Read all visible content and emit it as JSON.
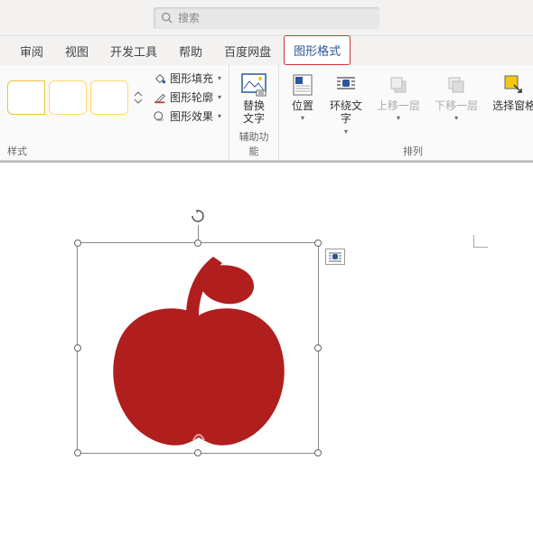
{
  "search": {
    "placeholder": "搜索"
  },
  "tabs": {
    "items": [
      {
        "label": "审阅"
      },
      {
        "label": "视图"
      },
      {
        "label": "开发工具"
      },
      {
        "label": "帮助"
      },
      {
        "label": "百度网盘"
      },
      {
        "label": "图形格式"
      }
    ],
    "active_index": 5
  },
  "ribbon": {
    "styles": {
      "group_label": "样式",
      "fill": "图形填充",
      "outline": "图形轮廓",
      "effects": "图形效果"
    },
    "accessibility": {
      "group_label": "辅助功能",
      "alt_text": "替换\n文字"
    },
    "arrange": {
      "group_label": "排列",
      "position": "位置",
      "wrap": "环绕文\n字",
      "forward": "上移一层",
      "backward": "下移一层",
      "selection": "选择窗格"
    }
  },
  "shape": {
    "name": "apple",
    "fill": "#b01e1e"
  }
}
